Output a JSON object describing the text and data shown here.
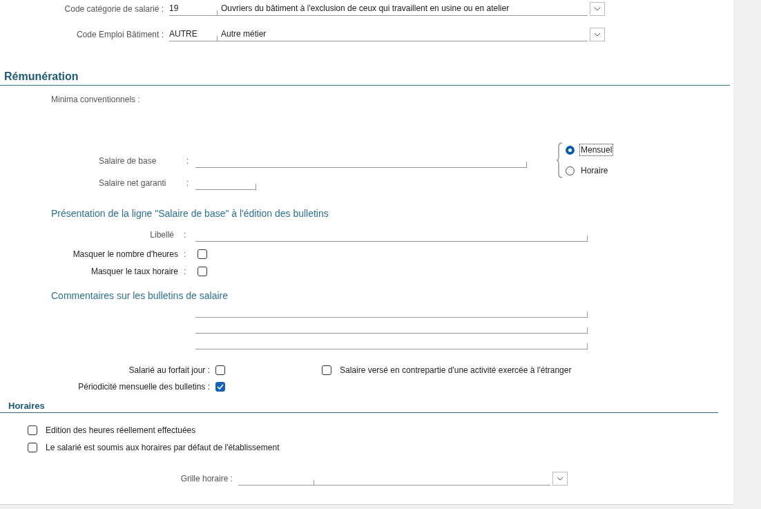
{
  "employment_codes": [
    {
      "label": "Code catégorie de salarié :",
      "code": "19",
      "description": "Ouvriers du bâtiment à l'exclusion de ceux qui travaillent en usine ou en atelier"
    },
    {
      "label": "Code Emploi Bâtiment :",
      "code": "AUTRE",
      "description": "Autre métier"
    }
  ],
  "remuneration": {
    "title": "Rémunération",
    "minima_label": "Minima conventionnels :",
    "salary_fields": [
      {
        "label": "Salaire de base",
        "separator": ":"
      },
      {
        "label": "Salaire net garanti",
        "separator": ":"
      }
    ],
    "pay_basis": [
      {
        "label": "Mensuel",
        "selected": true,
        "focused": true
      },
      {
        "label": "Horaire",
        "selected": false,
        "focused": false
      }
    ],
    "presentation_title": "Présentation de la ligne \"Salaire de base\" à l'édition des bulletins",
    "libelle": {
      "label": "Libellé",
      "separator": ":"
    },
    "hide_options": [
      {
        "label": "Masquer le nombre d'heures",
        "separator": ":",
        "checked": false
      },
      {
        "label": "Masquer le taux horaire",
        "separator": ":",
        "checked": false
      }
    ],
    "comments_title": "Commentaires sur les bulletins de salaire",
    "forfait": {
      "label": "Salarié au forfait jour :",
      "checked": false
    },
    "abroad": {
      "label": "Salaire versé en contrepartie d'une activité exercée à l'étranger",
      "checked": false
    },
    "monthly": {
      "label": "Périodicité mensuelle des bulletins :",
      "checked": true
    }
  },
  "horaires": {
    "title": "Horaires",
    "options": [
      {
        "label": "Edition des heures réellement effectuées",
        "checked": false
      },
      {
        "label": "Le salarié est soumis aux horaires par défaut de l'établissement",
        "checked": false
      }
    ],
    "grid_label": "Grille horaire :"
  }
}
